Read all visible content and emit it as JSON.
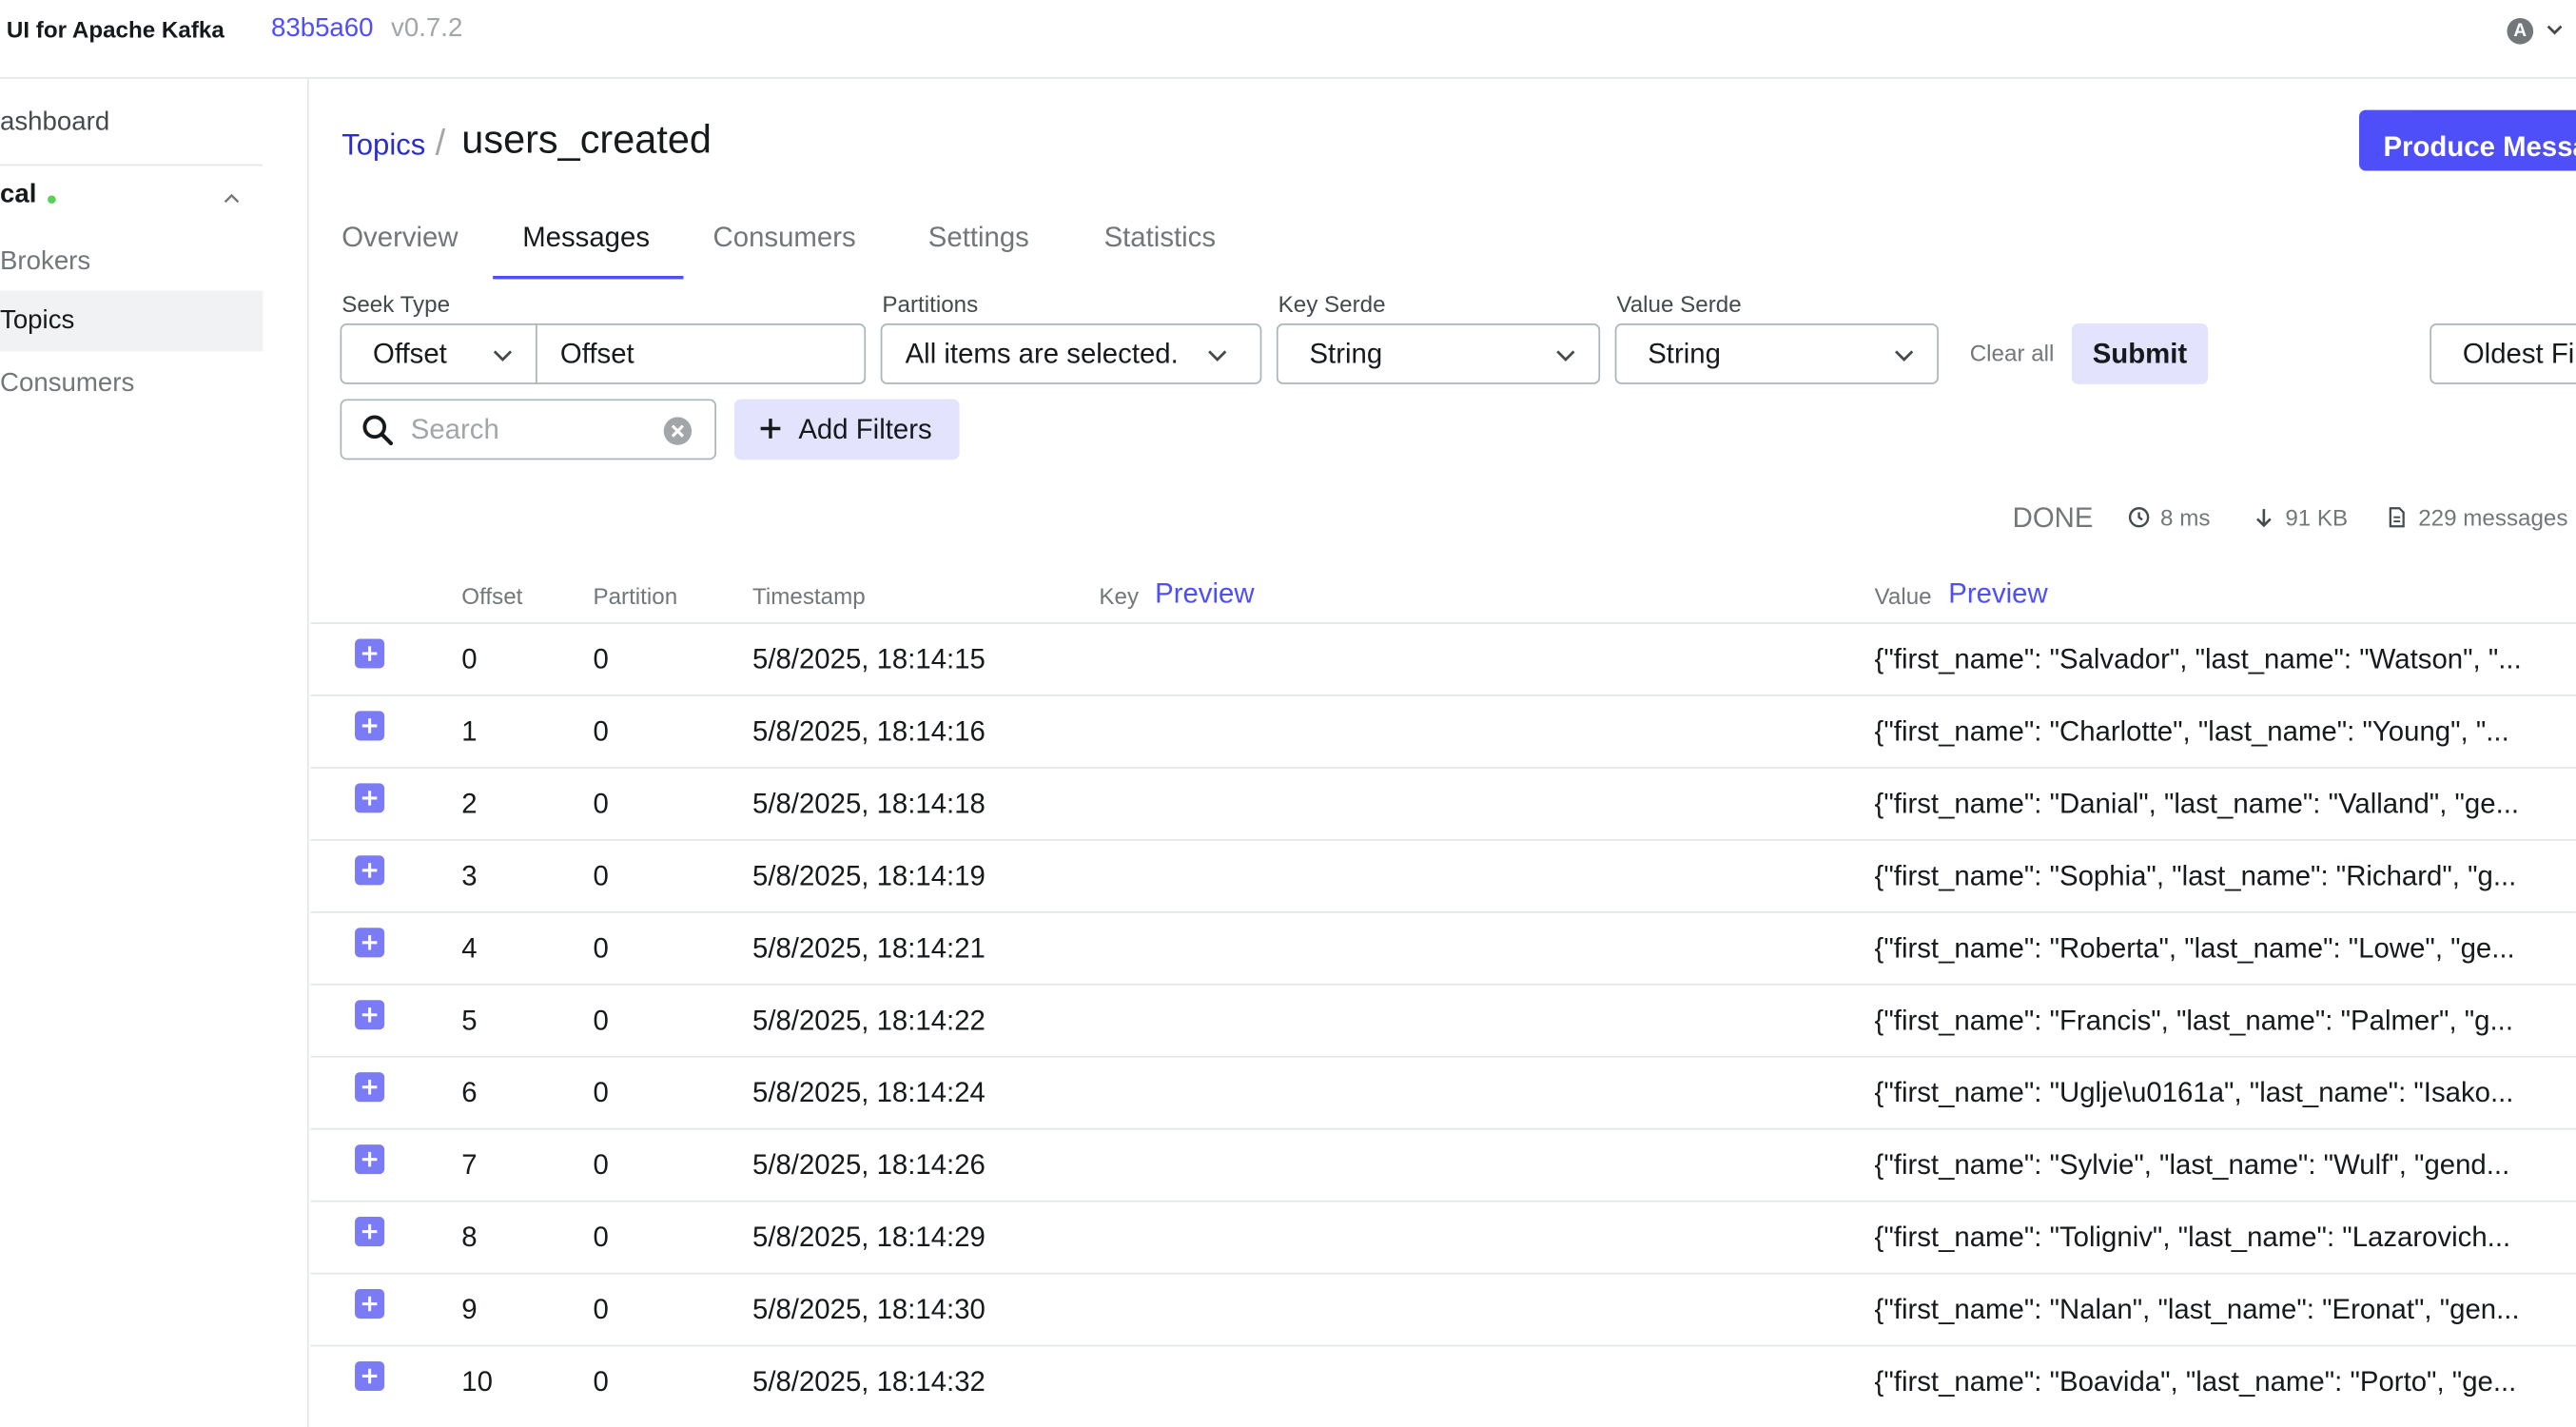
{
  "header": {
    "app_name": "UI for Apache Kafka",
    "version_hash": "83b5a60",
    "version": "v0.7.2",
    "avatar_letter": "A"
  },
  "sidebar": {
    "dashboard": "ashboard",
    "cluster": "cal",
    "items": [
      {
        "label": "Brokers"
      },
      {
        "label": "Topics"
      },
      {
        "label": "Consumers"
      }
    ]
  },
  "breadcrumb": {
    "parent": "Topics",
    "separator": "/",
    "title": "users_created"
  },
  "produce_button": "Produce Message",
  "tabs": [
    "Overview",
    "Messages",
    "Consumers",
    "Settings",
    "Statistics"
  ],
  "filters": {
    "seek_type_label": "Seek Type",
    "seek_type_value": "Offset",
    "offset_value": "Offset",
    "partitions_label": "Partitions",
    "partitions_value": "All items are selected.",
    "key_serde_label": "Key Serde",
    "key_serde_value": "String",
    "value_serde_label": "Value Serde",
    "value_serde_value": "String",
    "clear_all": "Clear all",
    "submit": "Submit",
    "order_value": "Oldest First",
    "search_placeholder": "Search",
    "add_filters": "Add Filters"
  },
  "stats": {
    "status": "DONE",
    "elapsed": "8 ms",
    "bytes": "91 KB",
    "messages": "229 messages"
  },
  "table": {
    "columns": {
      "offset": "Offset",
      "partition": "Partition",
      "timestamp": "Timestamp",
      "key": "Key",
      "value": "Value",
      "preview": "Preview"
    },
    "rows": [
      {
        "offset": "0",
        "partition": "0",
        "timestamp": "5/8/2025, 18:14:15",
        "value": "{\"first_name\": \"Salvador\", \"last_name\": \"Watson\", \"..."
      },
      {
        "offset": "1",
        "partition": "0",
        "timestamp": "5/8/2025, 18:14:16",
        "value": "{\"first_name\": \"Charlotte\", \"last_name\": \"Young\", \"..."
      },
      {
        "offset": "2",
        "partition": "0",
        "timestamp": "5/8/2025, 18:14:18",
        "value": "{\"first_name\": \"Danial\", \"last_name\": \"Valland\", \"ge..."
      },
      {
        "offset": "3",
        "partition": "0",
        "timestamp": "5/8/2025, 18:14:19",
        "value": "{\"first_name\": \"Sophia\", \"last_name\": \"Richard\", \"g..."
      },
      {
        "offset": "4",
        "partition": "0",
        "timestamp": "5/8/2025, 18:14:21",
        "value": "{\"first_name\": \"Roberta\", \"last_name\": \"Lowe\", \"ge..."
      },
      {
        "offset": "5",
        "partition": "0",
        "timestamp": "5/8/2025, 18:14:22",
        "value": "{\"first_name\": \"Francis\", \"last_name\": \"Palmer\", \"g..."
      },
      {
        "offset": "6",
        "partition": "0",
        "timestamp": "5/8/2025, 18:14:24",
        "value": "{\"first_name\": \"Uglje\\u0161a\", \"last_name\": \"Isako..."
      },
      {
        "offset": "7",
        "partition": "0",
        "timestamp": "5/8/2025, 18:14:26",
        "value": "{\"first_name\": \"Sylvie\", \"last_name\": \"Wulf\", \"gend..."
      },
      {
        "offset": "8",
        "partition": "0",
        "timestamp": "5/8/2025, 18:14:29",
        "value": "{\"first_name\": \"Toligniv\", \"last_name\": \"Lazarovich..."
      },
      {
        "offset": "9",
        "partition": "0",
        "timestamp": "5/8/2025, 18:14:30",
        "value": "{\"first_name\": \"Nalan\", \"last_name\": \"Eronat\", \"gen..."
      },
      {
        "offset": "10",
        "partition": "0",
        "timestamp": "5/8/2025, 18:14:32",
        "value": "{\"first_name\": \"Boavida\", \"last_name\": \"Porto\", \"ge..."
      }
    ]
  },
  "colors": {
    "accent": "#4f4ffa",
    "link": "#2a2fc7",
    "status_dot": "#5ad05a",
    "expand_button": "#7b7cf5"
  }
}
